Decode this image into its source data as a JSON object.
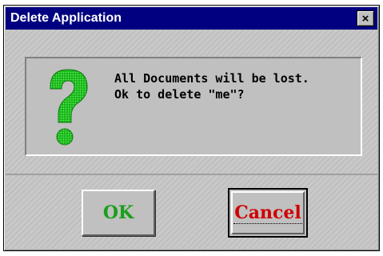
{
  "window": {
    "title": "Delete Application",
    "close_label": "×"
  },
  "message": {
    "line1": "All Documents will be lost.",
    "line2": "Ok to delete \"me\"?",
    "icon": "question-mark-icon"
  },
  "buttons": {
    "ok_label": "OK",
    "cancel_label": "Cancel"
  },
  "colors": {
    "titlebar": "#000080",
    "ok_text": "#18a018",
    "cancel_text": "#d00000",
    "icon_green": "#22cc22"
  }
}
